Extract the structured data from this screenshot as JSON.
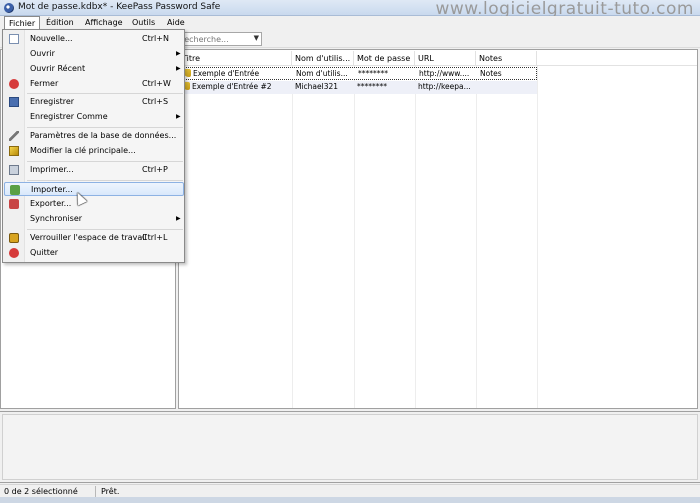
{
  "window": {
    "title": "Mot de passe.kdbx* - KeePass Password Safe",
    "watermark": "www.logicielgratuit-tuto.com"
  },
  "menubar": [
    "Fichier",
    "Édition",
    "Affichage",
    "Outils",
    "Aide"
  ],
  "toolbar": {
    "search_placeholder": "Recherche..."
  },
  "table": {
    "columns": [
      "Titre",
      "Nom d'utilis...",
      "Mot de passe",
      "URL",
      "Notes"
    ],
    "rows": [
      {
        "title": "Exemple d'Entrée",
        "user": "Nom d'utilis...",
        "password": "********",
        "url": "http://www....",
        "notes": "Notes"
      },
      {
        "title": "Exemple d'Entrée #2",
        "user": "Michael321",
        "password": "********",
        "url": "http://keepa...",
        "notes": ""
      }
    ]
  },
  "file_menu": {
    "items": [
      {
        "label": "Nouvelle...",
        "shortcut": "Ctrl+N",
        "icon": "new-file-icon"
      },
      {
        "label": "Ouvrir",
        "submenu": true
      },
      {
        "label": "Ouvrir Récent",
        "submenu": true
      },
      {
        "label": "Fermer",
        "shortcut": "Ctrl+W",
        "icon": "close-icon"
      },
      {
        "label": "Enregistrer",
        "shortcut": "Ctrl+S",
        "icon": "save-icon"
      },
      {
        "label": "Enregistrer Comme",
        "submenu": true
      },
      {
        "label": "Paramètres de la base de données...",
        "icon": "tools-icon"
      },
      {
        "label": "Modifier la clé principale...",
        "icon": "master-key-icon"
      },
      {
        "label": "Imprimer...",
        "shortcut": "Ctrl+P",
        "icon": "print-icon"
      },
      {
        "label": "Importer...",
        "icon": "import-icon",
        "highlighted": true
      },
      {
        "label": "Exporter...",
        "icon": "export-icon"
      },
      {
        "label": "Synchroniser",
        "submenu": true
      },
      {
        "label": "Verrouiller l'espace de travail",
        "shortcut": "Ctrl+L",
        "icon": "lock-icon"
      },
      {
        "label": "Quitter",
        "icon": "quit-icon"
      }
    ],
    "submenu_arrow": "▶"
  },
  "statusbar": {
    "selection": "0 de 2 sélectionné",
    "state": "Prêt."
  }
}
